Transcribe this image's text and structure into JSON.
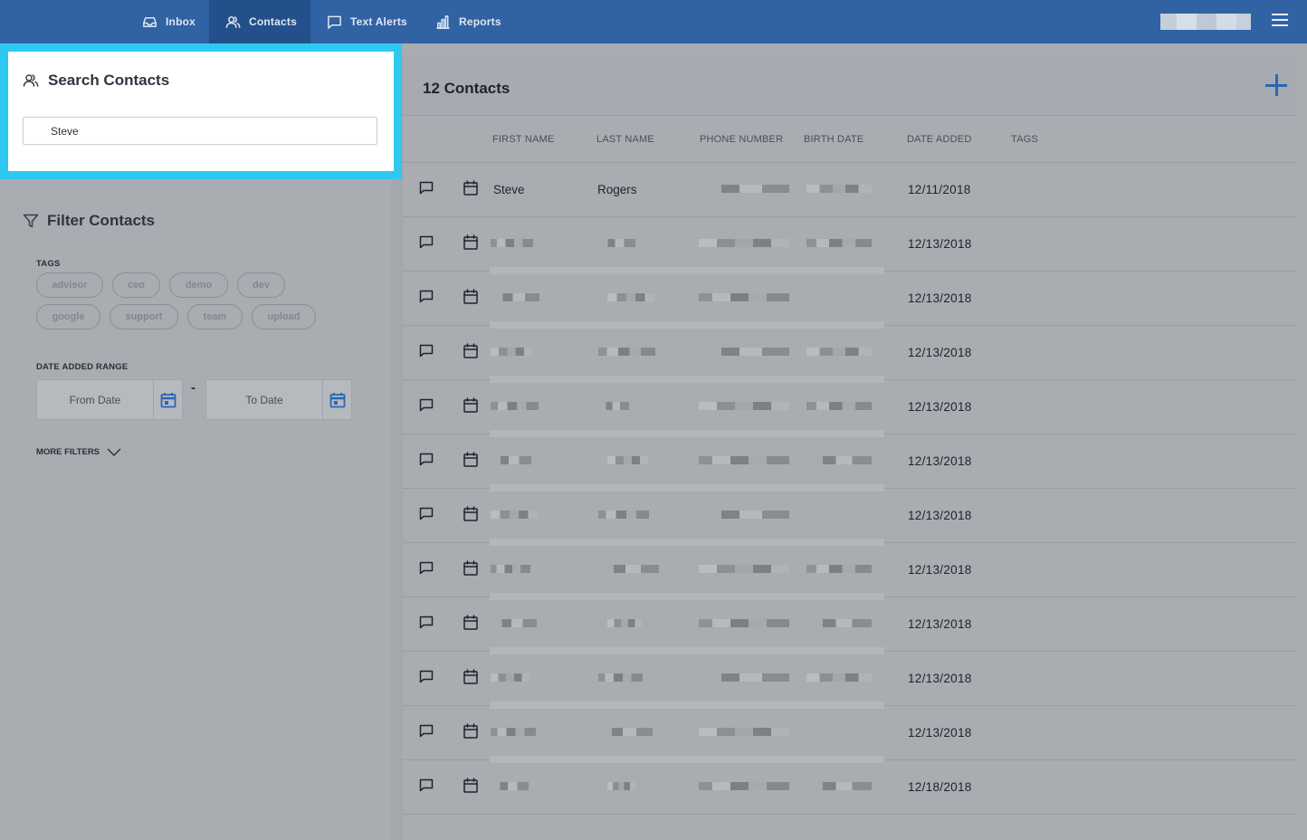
{
  "nav": {
    "tabs": [
      {
        "label": "Inbox",
        "icon": "inbox-icon"
      },
      {
        "label": "Contacts",
        "icon": "contacts-icon",
        "active": true
      },
      {
        "label": "Text Alerts",
        "icon": "chat-icon"
      },
      {
        "label": "Reports",
        "icon": "bar-chart-icon"
      }
    ],
    "menu_icon": "hamburger-icon"
  },
  "search": {
    "title": "Search Contacts",
    "value": "Steve"
  },
  "filter": {
    "title": "Filter Contacts",
    "tags_label": "TAGS",
    "tags": [
      "advisor",
      "ceo",
      "demo",
      "dev",
      "google",
      "support",
      "team",
      "upload"
    ],
    "date_range_label": "DATE ADDED RANGE",
    "from_placeholder": "From Date",
    "to_placeholder": "To Date",
    "separator": "-",
    "more_filters_label": "MORE FILTERS"
  },
  "contacts": {
    "count_label": "12 Contacts",
    "columns": [
      "FIRST NAME",
      "LAST NAME",
      "PHONE NUMBER",
      "BIRTH DATE",
      "DATE ADDED",
      "TAGS"
    ],
    "rows": [
      {
        "first_name": "Steve",
        "last_name": "Rogers",
        "date_added": "12/11/2018"
      },
      {
        "first_name": "",
        "last_name": "",
        "date_added": "12/13/2018"
      },
      {
        "first_name": "",
        "last_name": "",
        "date_added": "12/13/2018"
      },
      {
        "first_name": "",
        "last_name": "",
        "date_added": "12/13/2018"
      },
      {
        "first_name": "",
        "last_name": "",
        "date_added": "12/13/2018"
      },
      {
        "first_name": "",
        "last_name": "",
        "date_added": "12/13/2018"
      },
      {
        "first_name": "",
        "last_name": "",
        "date_added": "12/13/2018"
      },
      {
        "first_name": "",
        "last_name": "",
        "date_added": "12/13/2018"
      },
      {
        "first_name": "",
        "last_name": "",
        "date_added": "12/13/2018"
      },
      {
        "first_name": "",
        "last_name": "",
        "date_added": "12/13/2018"
      },
      {
        "first_name": "",
        "last_name": "",
        "date_added": "12/13/2018"
      },
      {
        "first_name": "",
        "last_name": "",
        "date_added": "12/18/2018"
      }
    ]
  },
  "colors": {
    "nav_bar": "#3062a4",
    "nav_active": "#23508b",
    "highlight_border": "#2ec9f0",
    "accent": "#2a66b8"
  }
}
